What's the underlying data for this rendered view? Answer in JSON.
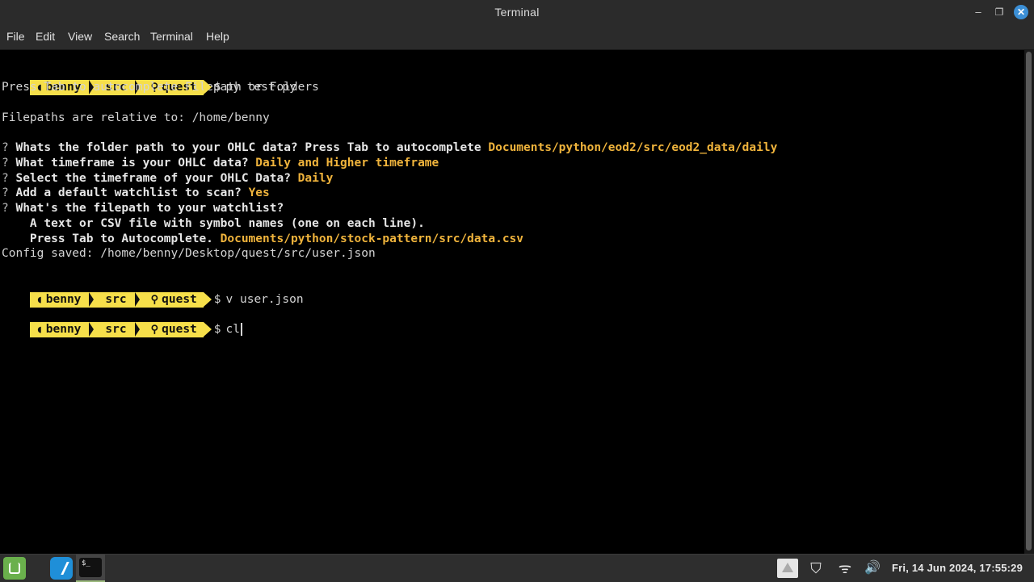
{
  "window": {
    "title": "Terminal",
    "minimize_glyph": "–",
    "maximize_glyph": "❐",
    "close_glyph": "✕"
  },
  "menu": [
    "File",
    "Edit",
    "View",
    "Search",
    "Terminal",
    "Help"
  ],
  "prompt": {
    "user": "benny",
    "dir": "src",
    "venv": "quest",
    "dollar": "$"
  },
  "terminal": {
    "cmd1": "py test.py",
    "line_tab_hint": "Press Tab to autocomplete Filepath or Folders",
    "line_relative": "Filepaths are relative to: /home/benny",
    "q_mark": "?",
    "q1": "Whats the folder path to your OHLC data? Press Tab to autocomplete ",
    "a1": "Documents/python/eod2/src/eod2_data/daily",
    "q2": "What timeframe is your OHLC data? ",
    "a2": "Daily and Higher timeframe",
    "q3": "Select the timeframe of your OHLC Data? ",
    "a3": "Daily",
    "q4": "Add a default watchlist to scan? ",
    "a4": "Yes",
    "q5": "What's the filepath to your watchlist?",
    "q5_sub1": "  A text or CSV file with symbol names (one on each line).",
    "q5_sub2": "  Press Tab to Autocomplete. ",
    "a5": "Documents/python/stock-pattern/src/data.csv",
    "config_saved": "Config saved: /home/benny/Desktop/quest/src/user.json",
    "cmd2": "v user.json",
    "cmd3": "cl"
  },
  "taskbar": {
    "terminal_glyph": "$_",
    "clock": "Fri, 14 Jun 2024, 17:55:29"
  },
  "icons": {
    "shield": "⛉",
    "wifi": "ᯤ",
    "volume": "🔊"
  }
}
